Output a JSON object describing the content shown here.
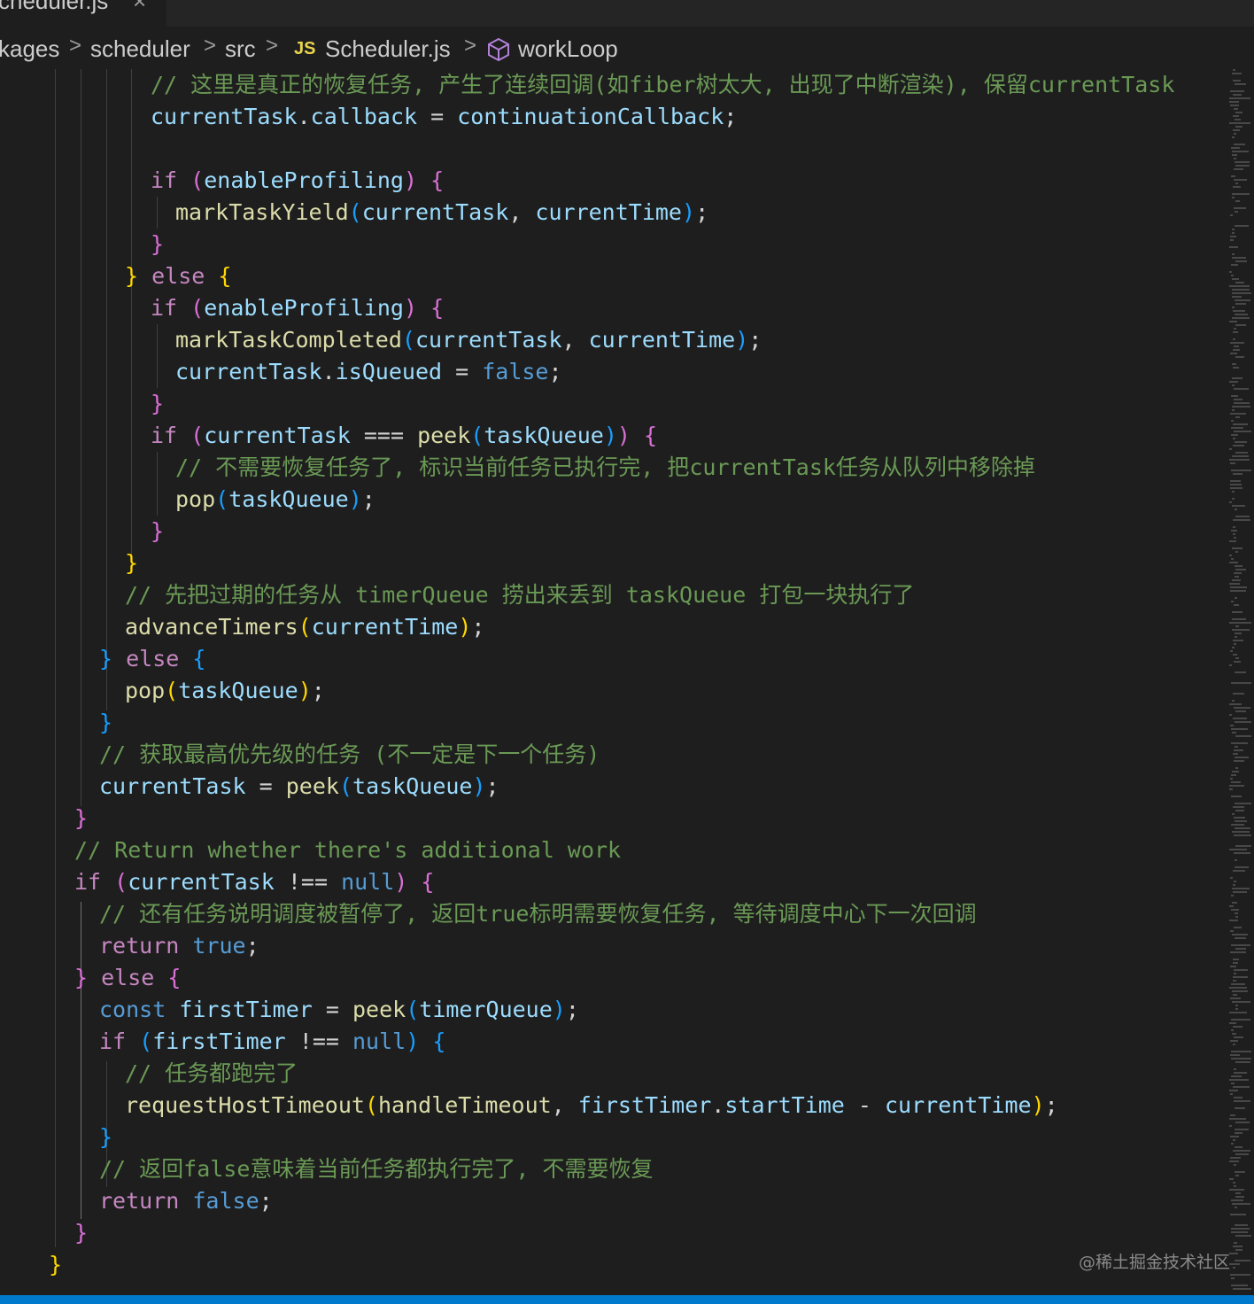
{
  "tab": {
    "label": "cheduler.js",
    "close": "×"
  },
  "breadcrumb": {
    "items": [
      "kages",
      "scheduler",
      "src",
      "Scheduler.js",
      "workLoop"
    ],
    "separator": ">",
    "file_badge": "JS"
  },
  "code_lines": [
    [
      {
        "t": "// 这里是真正的恢复任务, 产生了连续回调(如fiber树太大, 出现了中断渲染), 保留currentTask",
        "c": "c"
      }
    ],
    [
      {
        "t": "currentTask",
        "c": "v"
      },
      {
        "t": ".",
        "c": "p"
      },
      {
        "t": "callback",
        "c": "v"
      },
      {
        "t": " = ",
        "c": "p"
      },
      {
        "t": "continuationCallback",
        "c": "v"
      },
      {
        "t": ";",
        "c": "p"
      }
    ],
    [],
    [
      {
        "t": "if ",
        "c": "k"
      },
      {
        "t": "(",
        "c": "b2"
      },
      {
        "t": "enableProfiling",
        "c": "v"
      },
      {
        "t": ")",
        "c": "b2"
      },
      {
        "t": " ",
        "c": "p"
      },
      {
        "t": "{",
        "c": "b2"
      }
    ],
    [
      {
        "t": "markTaskYield",
        "c": "f"
      },
      {
        "t": "(",
        "c": "b3"
      },
      {
        "t": "currentTask",
        "c": "v"
      },
      {
        "t": ", ",
        "c": "p"
      },
      {
        "t": "currentTime",
        "c": "v"
      },
      {
        "t": ")",
        "c": "b3"
      },
      {
        "t": ";",
        "c": "p"
      }
    ],
    [
      {
        "t": "}",
        "c": "b2"
      }
    ],
    [
      {
        "t": "}",
        "c": "b1"
      },
      {
        "t": " else ",
        "c": "k"
      },
      {
        "t": "{",
        "c": "b1"
      }
    ],
    [
      {
        "t": "if ",
        "c": "k"
      },
      {
        "t": "(",
        "c": "b2"
      },
      {
        "t": "enableProfiling",
        "c": "v"
      },
      {
        "t": ")",
        "c": "b2"
      },
      {
        "t": " ",
        "c": "p"
      },
      {
        "t": "{",
        "c": "b2"
      }
    ],
    [
      {
        "t": "markTaskCompleted",
        "c": "f"
      },
      {
        "t": "(",
        "c": "b3"
      },
      {
        "t": "currentTask",
        "c": "v"
      },
      {
        "t": ", ",
        "c": "p"
      },
      {
        "t": "currentTime",
        "c": "v"
      },
      {
        "t": ")",
        "c": "b3"
      },
      {
        "t": ";",
        "c": "p"
      }
    ],
    [
      {
        "t": "currentTask",
        "c": "v"
      },
      {
        "t": ".",
        "c": "p"
      },
      {
        "t": "isQueued",
        "c": "v"
      },
      {
        "t": " = ",
        "c": "p"
      },
      {
        "t": "false",
        "c": "kb"
      },
      {
        "t": ";",
        "c": "p"
      }
    ],
    [
      {
        "t": "}",
        "c": "b2"
      }
    ],
    [
      {
        "t": "if ",
        "c": "k"
      },
      {
        "t": "(",
        "c": "b2"
      },
      {
        "t": "currentTask",
        "c": "v"
      },
      {
        "t": " === ",
        "c": "p"
      },
      {
        "t": "peek",
        "c": "f"
      },
      {
        "t": "(",
        "c": "b3"
      },
      {
        "t": "taskQueue",
        "c": "v"
      },
      {
        "t": ")",
        "c": "b3"
      },
      {
        "t": ")",
        "c": "b2"
      },
      {
        "t": " ",
        "c": "p"
      },
      {
        "t": "{",
        "c": "b2"
      }
    ],
    [
      {
        "t": "// 不需要恢复任务了, 标识当前任务已执行完, 把currentTask任务从队列中移除掉",
        "c": "c"
      }
    ],
    [
      {
        "t": "pop",
        "c": "f"
      },
      {
        "t": "(",
        "c": "b3"
      },
      {
        "t": "taskQueue",
        "c": "v"
      },
      {
        "t": ")",
        "c": "b3"
      },
      {
        "t": ";",
        "c": "p"
      }
    ],
    [
      {
        "t": "}",
        "c": "b2"
      }
    ],
    [
      {
        "t": "}",
        "c": "b1"
      }
    ],
    [
      {
        "t": "// 先把过期的任务从 timerQueue 捞出来丢到 taskQueue 打包一块执行了",
        "c": "c"
      }
    ],
    [
      {
        "t": "advanceTimers",
        "c": "f"
      },
      {
        "t": "(",
        "c": "b1"
      },
      {
        "t": "currentTime",
        "c": "v"
      },
      {
        "t": ")",
        "c": "b1"
      },
      {
        "t": ";",
        "c": "p"
      }
    ],
    [
      {
        "t": "}",
        "c": "b3"
      },
      {
        "t": " else ",
        "c": "k"
      },
      {
        "t": "{",
        "c": "b3"
      }
    ],
    [
      {
        "t": "pop",
        "c": "f"
      },
      {
        "t": "(",
        "c": "b1"
      },
      {
        "t": "taskQueue",
        "c": "v"
      },
      {
        "t": ")",
        "c": "b1"
      },
      {
        "t": ";",
        "c": "p"
      }
    ],
    [
      {
        "t": "}",
        "c": "b3"
      }
    ],
    [
      {
        "t": "// 获取最高优先级的任务 (不一定是下一个任务)",
        "c": "c"
      }
    ],
    [
      {
        "t": "currentTask",
        "c": "v"
      },
      {
        "t": " = ",
        "c": "p"
      },
      {
        "t": "peek",
        "c": "f"
      },
      {
        "t": "(",
        "c": "b3"
      },
      {
        "t": "taskQueue",
        "c": "v"
      },
      {
        "t": ")",
        "c": "b3"
      },
      {
        "t": ";",
        "c": "p"
      }
    ],
    [
      {
        "t": "}",
        "c": "b2"
      }
    ],
    [
      {
        "t": "// Return whether there's additional work",
        "c": "c"
      }
    ],
    [
      {
        "t": "if ",
        "c": "k"
      },
      {
        "t": "(",
        "c": "b2"
      },
      {
        "t": "currentTask",
        "c": "v"
      },
      {
        "t": " !== ",
        "c": "p"
      },
      {
        "t": "null",
        "c": "kb"
      },
      {
        "t": ")",
        "c": "b2"
      },
      {
        "t": " ",
        "c": "p"
      },
      {
        "t": "{",
        "c": "b2"
      }
    ],
    [
      {
        "t": "// 还有任务说明调度被暂停了, 返回true标明需要恢复任务, 等待调度中心下一次回调",
        "c": "c"
      }
    ],
    [
      {
        "t": "return ",
        "c": "k"
      },
      {
        "t": "true",
        "c": "kb"
      },
      {
        "t": ";",
        "c": "p"
      }
    ],
    [
      {
        "t": "}",
        "c": "b2"
      },
      {
        "t": " else ",
        "c": "k"
      },
      {
        "t": "{",
        "c": "b2"
      }
    ],
    [
      {
        "t": "const ",
        "c": "kb"
      },
      {
        "t": "firstTimer",
        "c": "v"
      },
      {
        "t": " = ",
        "c": "p"
      },
      {
        "t": "peek",
        "c": "f"
      },
      {
        "t": "(",
        "c": "b3"
      },
      {
        "t": "timerQueue",
        "c": "v"
      },
      {
        "t": ")",
        "c": "b3"
      },
      {
        "t": ";",
        "c": "p"
      }
    ],
    [
      {
        "t": "if ",
        "c": "k"
      },
      {
        "t": "(",
        "c": "b3"
      },
      {
        "t": "firstTimer",
        "c": "v"
      },
      {
        "t": " !== ",
        "c": "p"
      },
      {
        "t": "null",
        "c": "kb"
      },
      {
        "t": ")",
        "c": "b3"
      },
      {
        "t": " ",
        "c": "p"
      },
      {
        "t": "{",
        "c": "b3"
      }
    ],
    [
      {
        "t": "// 任务都跑完了",
        "c": "c"
      }
    ],
    [
      {
        "t": "requestHostTimeout",
        "c": "f"
      },
      {
        "t": "(",
        "c": "b1"
      },
      {
        "t": "handleTimeout",
        "c": "f"
      },
      {
        "t": ", ",
        "c": "p"
      },
      {
        "t": "firstTimer",
        "c": "v"
      },
      {
        "t": ".",
        "c": "p"
      },
      {
        "t": "startTime",
        "c": "v"
      },
      {
        "t": " - ",
        "c": "p"
      },
      {
        "t": "currentTime",
        "c": "v"
      },
      {
        "t": ")",
        "c": "b1"
      },
      {
        "t": ";",
        "c": "p"
      }
    ],
    [
      {
        "t": "}",
        "c": "b3"
      }
    ],
    [
      {
        "t": "// 返回false意味着当前任务都执行完了, 不需要恢复",
        "c": "c"
      }
    ],
    [
      {
        "t": "return ",
        "c": "k"
      },
      {
        "t": "false",
        "c": "kb"
      },
      {
        "t": ";",
        "c": "p"
      }
    ],
    [
      {
        "t": "}",
        "c": "b2"
      }
    ],
    [
      {
        "t": "}",
        "c": "b1"
      }
    ]
  ],
  "watermark": "@稀土掘金技术社区"
}
